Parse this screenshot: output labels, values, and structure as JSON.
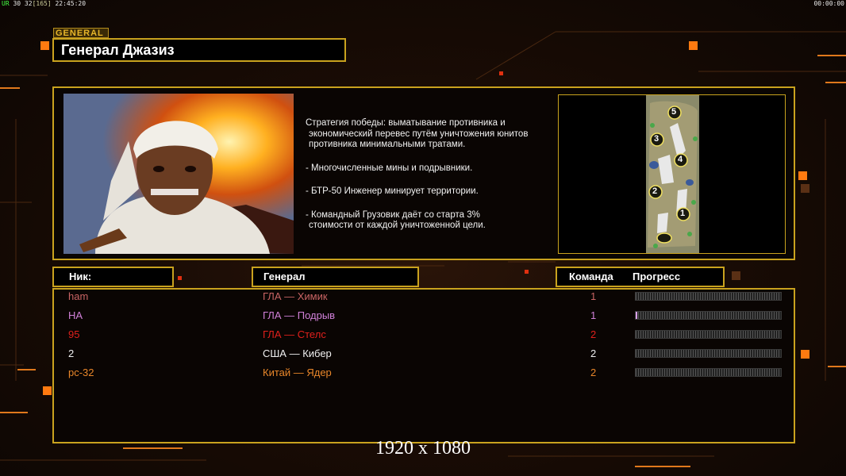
{
  "hud": {
    "fps_label": "UR",
    "fps_values": "30 32",
    "frame_bracket": "[165]",
    "clock": "22:45:20",
    "timer": "00:00:00"
  },
  "general": {
    "tag": "GENERAL",
    "name": "Генерал Джазиз",
    "description": [
      "Стратегия победы: выматывание противника и",
      "экономический перевес путём уничтожения юнитов",
      "противника минимальными тратами."
    ],
    "bullets": [
      "- Многочисленные мины и подрывники.",
      "- БТР-50 Инженер минирует территории.",
      "- Командный Грузовик даёт со старта 3%",
      "стоимости от каждой уничтоженной цели."
    ]
  },
  "map": {
    "start_positions": [
      "5",
      "3",
      "4",
      "2",
      "1"
    ]
  },
  "table": {
    "headers": {
      "nick": "Ник:",
      "general": "Генерал",
      "team": "Команда",
      "progress": "Прогресс"
    },
    "rows": [
      {
        "nick": "ham",
        "general": "ГЛА — Химик",
        "team": "1",
        "color": "#c86464",
        "progress": 0
      },
      {
        "nick": "HA",
        "general": "ГЛА — Подрыв",
        "team": "1",
        "color": "#d080d8",
        "progress": 0.01
      },
      {
        "nick": "95",
        "general": "ГЛА — Стелс",
        "team": "2",
        "color": "#e0201c",
        "progress": 0
      },
      {
        "nick": "2",
        "general": "США — Кибер",
        "team": "2",
        "color": "#f0f0f0",
        "progress": 0
      },
      {
        "nick": "pc-32",
        "general": "Китай — Ядер",
        "team": "2",
        "color": "#e8862a",
        "progress": 0
      }
    ]
  },
  "watermark": "1920 x 1080",
  "colors": {
    "frame": "#c9a21e",
    "accent_orange": "#ff7a10"
  }
}
